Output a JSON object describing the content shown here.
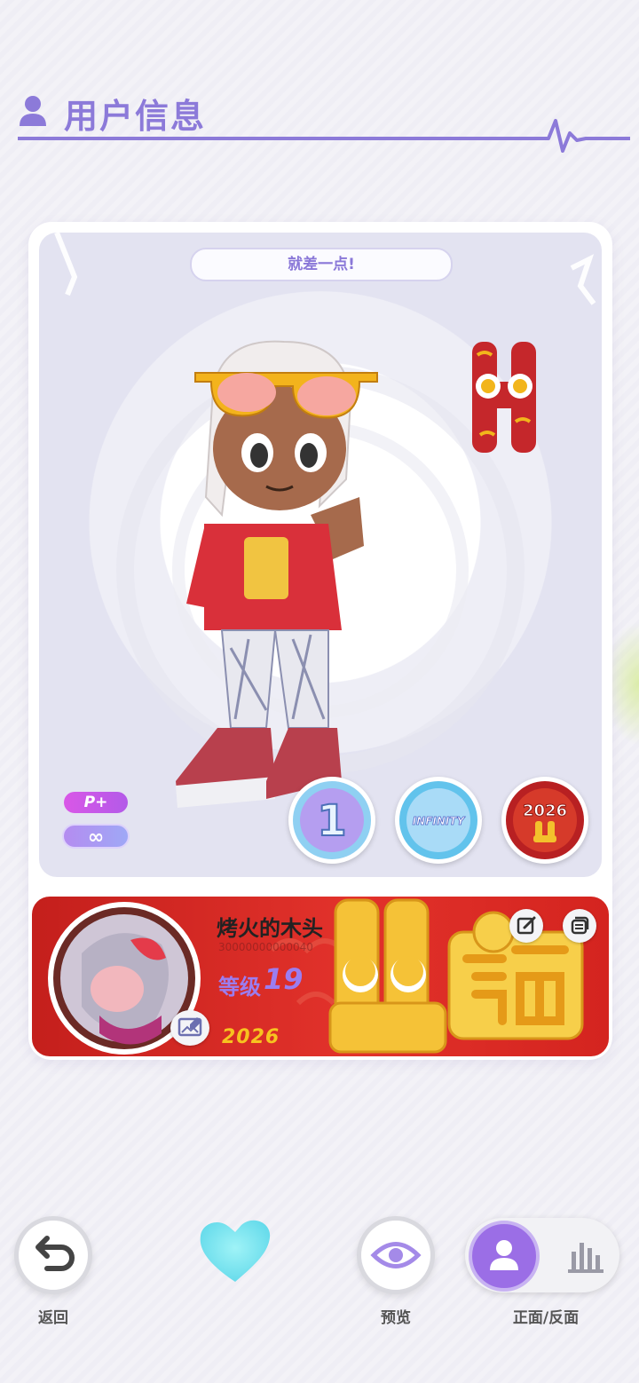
{
  "header": {
    "title": "用户信息"
  },
  "card": {
    "tip": "就差一点!",
    "tags": {
      "pplus": "P+",
      "infinity": "∞"
    },
    "badges": [
      "1",
      "INFINITY",
      "2026"
    ]
  },
  "profile": {
    "nickname": "烤火的木头",
    "uid": "30000000000040",
    "level_label": "等级",
    "level": "19",
    "year_text": "2026"
  },
  "nav": {
    "back_label": "返回",
    "preview_label": "预览",
    "flip_label": "正面/反面"
  },
  "colors": {
    "accent": "#8c7ad9",
    "banner_red": "#d4241f",
    "gold": "#f7c31f"
  }
}
